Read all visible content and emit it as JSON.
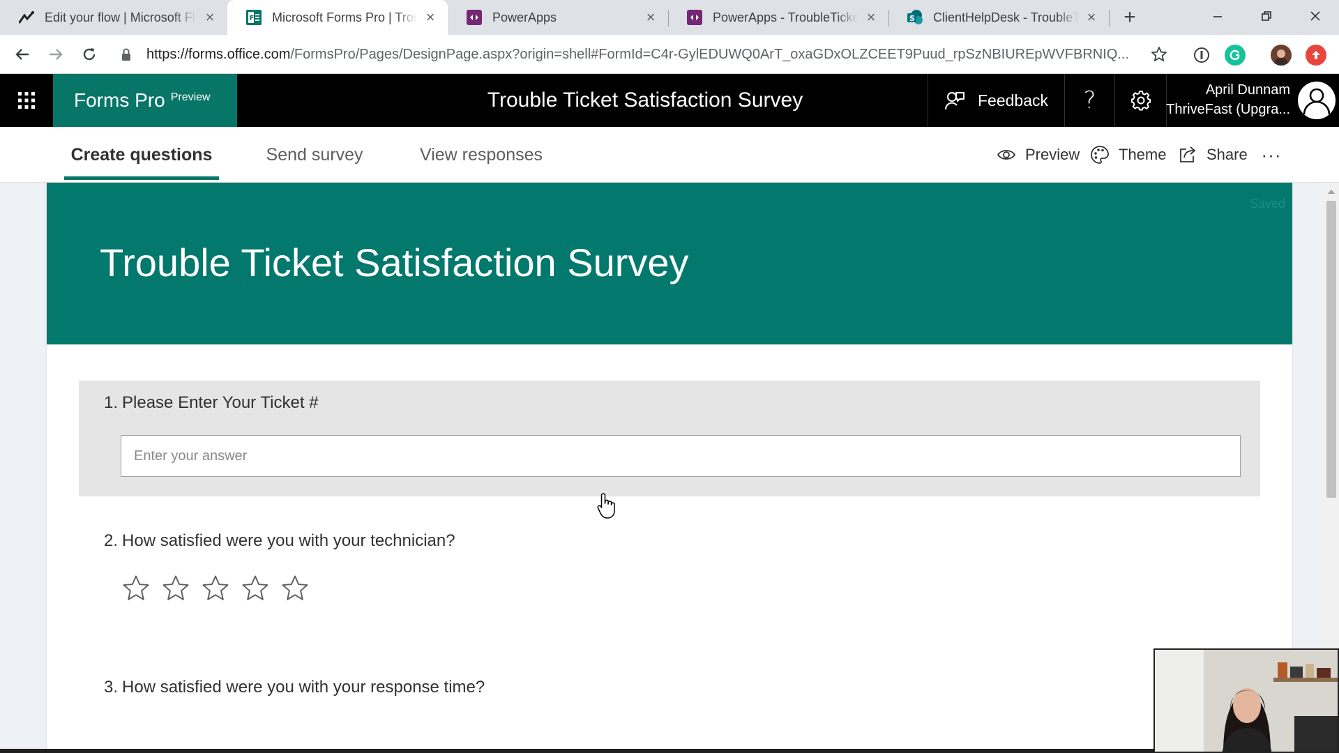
{
  "browser": {
    "tabs": [
      {
        "title": "Edit your flow | Microsoft Flow",
        "icon": "flow-icon",
        "active": false
      },
      {
        "title": "Microsoft Forms Pro | Trouble Ticket Satisfaction Survey",
        "icon": "forms-icon",
        "active": true
      },
      {
        "title": "PowerApps",
        "icon": "powerapps-icon",
        "active": false
      },
      {
        "title": "PowerApps - TroubleTickets",
        "icon": "powerapps-icon",
        "active": false
      },
      {
        "title": "ClientHelpDesk - TroubleTickets",
        "icon": "sharepoint-icon",
        "active": false
      }
    ],
    "new_tab_label": "+",
    "close_glyph": "×",
    "url_host": "https://forms.office.com",
    "url_path": "/FormsPro/Pages/DesignPage.aspx?origin=shell#FormId=C4r-GylEDUWQ0ArT_oxaGDxOLZCEET9Puud_rpSzNBIUREpWVFBRNIQ..."
  },
  "app_header": {
    "brand_name": "Forms Pro",
    "brand_badge": "Preview",
    "title": "Trouble Ticket Satisfaction Survey",
    "feedback_label": "Feedback",
    "help_glyph": "?",
    "user_name": "April Dunnam",
    "user_tenant": "ThriveFast (Upgra..."
  },
  "command_bar": {
    "tabs": [
      {
        "label": "Create questions",
        "active": true
      },
      {
        "label": "Send survey",
        "active": false
      },
      {
        "label": "View responses",
        "active": false
      }
    ],
    "actions": [
      {
        "label": "Preview",
        "icon": "eye-icon"
      },
      {
        "label": "Theme",
        "icon": "palette-icon"
      },
      {
        "label": "Share",
        "icon": "share-icon"
      }
    ],
    "more_glyph": "···"
  },
  "form": {
    "saved_label": "Saved",
    "title": "Trouble Ticket Satisfaction Survey",
    "accent_color": "#03786c",
    "questions": [
      {
        "number": "1.",
        "text": "Please Enter Your Ticket #",
        "type": "text",
        "placeholder": "Enter your answer"
      },
      {
        "number": "2.",
        "text": "How satisfied were you with your technician?",
        "type": "rating",
        "rating_max": 5
      },
      {
        "number": "3.",
        "text": "How satisfied were you with your response time?",
        "type": "rating"
      }
    ]
  }
}
